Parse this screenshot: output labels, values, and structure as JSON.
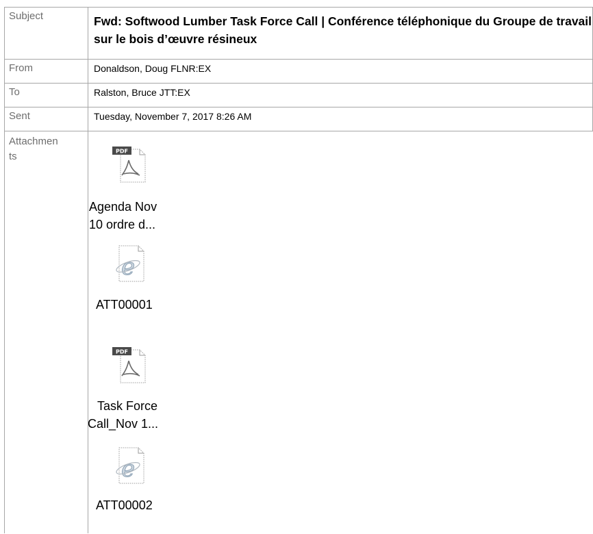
{
  "header": {
    "subject": {
      "label": "Subject",
      "value": "Fwd: Softwood Lumber Task Force Call | Conférence téléphonique du Groupe de travail sur le bois d’œuvre résineux"
    },
    "from": {
      "label": "From",
      "value": "Donaldson, Doug FLNR:EX"
    },
    "to": {
      "label": "To",
      "value": "Ralston, Bruce JTT:EX"
    },
    "sent": {
      "label": "Sent",
      "value": "Tuesday, November 7, 2017 8:26 AM"
    },
    "attachments": {
      "label_line1": "Attachmen",
      "label_line2": "ts"
    }
  },
  "attachments": [
    {
      "type": "pdf",
      "icon": "pdf-file-icon",
      "badge": "PDF",
      "name_line1": "Agenda Nov",
      "name_line2": "10 ordre d..."
    },
    {
      "type": "html",
      "icon": "ie-html-file-icon",
      "name_line1": "ATT00001"
    },
    {
      "type": "pdf",
      "icon": "pdf-file-icon",
      "badge": "PDF",
      "name_line1": "Task Force",
      "name_line2": "Call_Nov 1..."
    },
    {
      "type": "html",
      "icon": "ie-html-file-icon",
      "name_line1": "ATT00002"
    }
  ],
  "colors": {
    "border": "#a6a6a6",
    "label": "#6d6d6d",
    "pdf_badge": "#4a4a4a",
    "ie_blue": "#4d8fd6"
  }
}
